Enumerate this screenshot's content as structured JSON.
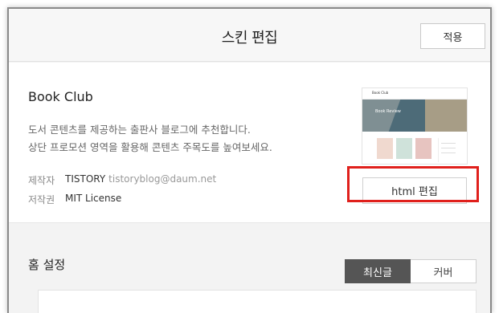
{
  "header": {
    "title": "스킨 편집",
    "apply_label": "적용"
  },
  "skin": {
    "name": "Book Club",
    "description_lines": [
      "도서 콘텐츠를 제공하는 출판사 블로그에 추천합니다.",
      "상단 프로모션 영역을 활용해 콘텐츠 주목도를 높여보세요."
    ],
    "meta": {
      "author_key": "제작자",
      "author_name": "TISTORY",
      "author_email": "tistoryblog@daum.net",
      "license_key": "저작권",
      "license_value": "MIT License"
    },
    "thumbnail": {
      "site_title": "Book Club",
      "hero_label": "Book Review"
    },
    "html_edit_label": "html 편집"
  },
  "home_settings": {
    "title": "홈 설정",
    "tabs": [
      {
        "label": "최신글",
        "active": true
      },
      {
        "label": "커버",
        "active": false
      }
    ]
  },
  "colors": {
    "highlight": "#e0201c",
    "active_tab": "#555555"
  }
}
